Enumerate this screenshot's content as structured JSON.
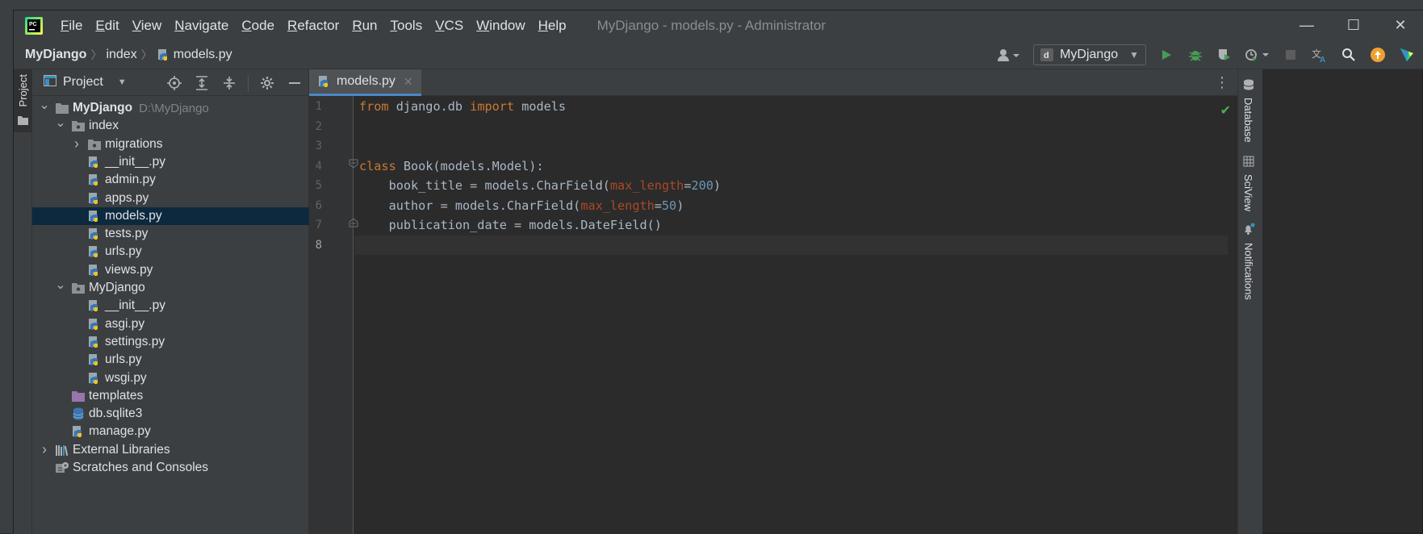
{
  "window": {
    "title": "MyDjango - models.py - Administrator",
    "menu": [
      "File",
      "Edit",
      "View",
      "Navigate",
      "Code",
      "Refactor",
      "Run",
      "Tools",
      "VCS",
      "Window",
      "Help"
    ],
    "menu_mnemonic": [
      "F",
      "E",
      "V",
      "N",
      "C",
      "R",
      "R",
      "T",
      "V",
      "W",
      "H"
    ],
    "controls": [
      "minimize-icon",
      "maximize-icon",
      "close-icon"
    ]
  },
  "breadcrumb": {
    "project": "MyDjango",
    "folder": "index",
    "file": "models.py"
  },
  "toolbar": {
    "run_config": "MyDjango",
    "accent_run": "#499c54",
    "accent_update": "#f0a030"
  },
  "project_panel": {
    "title": "Project",
    "tree": [
      {
        "label": "MyDjango",
        "path": "D:\\MyDjango",
        "kind": "folder",
        "depth": 0,
        "expanded": true,
        "bold": true
      },
      {
        "label": "index",
        "kind": "package",
        "depth": 1,
        "expanded": true
      },
      {
        "label": "migrations",
        "kind": "package",
        "depth": 2,
        "expanded": false
      },
      {
        "label": "__init__.py",
        "kind": "py",
        "depth": 2
      },
      {
        "label": "admin.py",
        "kind": "py",
        "depth": 2
      },
      {
        "label": "apps.py",
        "kind": "py",
        "depth": 2
      },
      {
        "label": "models.py",
        "kind": "py",
        "depth": 2,
        "selected": true
      },
      {
        "label": "tests.py",
        "kind": "py",
        "depth": 2
      },
      {
        "label": "urls.py",
        "kind": "py",
        "depth": 2
      },
      {
        "label": "views.py",
        "kind": "py",
        "depth": 2
      },
      {
        "label": "MyDjango",
        "kind": "package",
        "depth": 1,
        "expanded": true
      },
      {
        "label": "__init__.py",
        "kind": "py",
        "depth": 2
      },
      {
        "label": "asgi.py",
        "kind": "py",
        "depth": 2
      },
      {
        "label": "settings.py",
        "kind": "py",
        "depth": 2
      },
      {
        "label": "urls.py",
        "kind": "py",
        "depth": 2
      },
      {
        "label": "wsgi.py",
        "kind": "py",
        "depth": 2
      },
      {
        "label": "templates",
        "kind": "templates",
        "depth": 1
      },
      {
        "label": "db.sqlite3",
        "kind": "db",
        "depth": 1
      },
      {
        "label": "manage.py",
        "kind": "py",
        "depth": 1
      },
      {
        "label": "External Libraries",
        "kind": "libs",
        "depth": 0,
        "expanded": false
      },
      {
        "label": "Scratches and Consoles",
        "kind": "scratch",
        "depth": 0
      }
    ]
  },
  "editor": {
    "tab_label": "models.py",
    "line_numbers": [
      "1",
      "2",
      "3",
      "4",
      "5",
      "6",
      "7",
      "8"
    ],
    "current_line": 8,
    "lines": [
      [
        {
          "t": "from",
          "c": "kw"
        },
        {
          "t": " django.db ",
          "c": ""
        },
        {
          "t": "import",
          "c": "kw"
        },
        {
          "t": " models",
          "c": ""
        }
      ],
      [],
      [],
      [
        {
          "t": "class",
          "c": "kw"
        },
        {
          "t": " Book(models.Model):",
          "c": ""
        }
      ],
      [
        {
          "t": "    book_title = models.CharField(",
          "c": ""
        },
        {
          "t": "max_length",
          "c": "param"
        },
        {
          "t": "=",
          "c": ""
        },
        {
          "t": "200",
          "c": "num"
        },
        {
          "t": ")",
          "c": ""
        }
      ],
      [
        {
          "t": "    author = models.CharField(",
          "c": ""
        },
        {
          "t": "max_length",
          "c": "param"
        },
        {
          "t": "=",
          "c": ""
        },
        {
          "t": "50",
          "c": "num"
        },
        {
          "t": ")",
          "c": ""
        }
      ],
      [
        {
          "t": "    publication_date = models.DateField()",
          "c": ""
        }
      ],
      []
    ]
  },
  "left_strip": {
    "project_tab": "Project"
  },
  "right_strip": {
    "tabs": [
      "Database",
      "SciView",
      "Notifications"
    ]
  }
}
